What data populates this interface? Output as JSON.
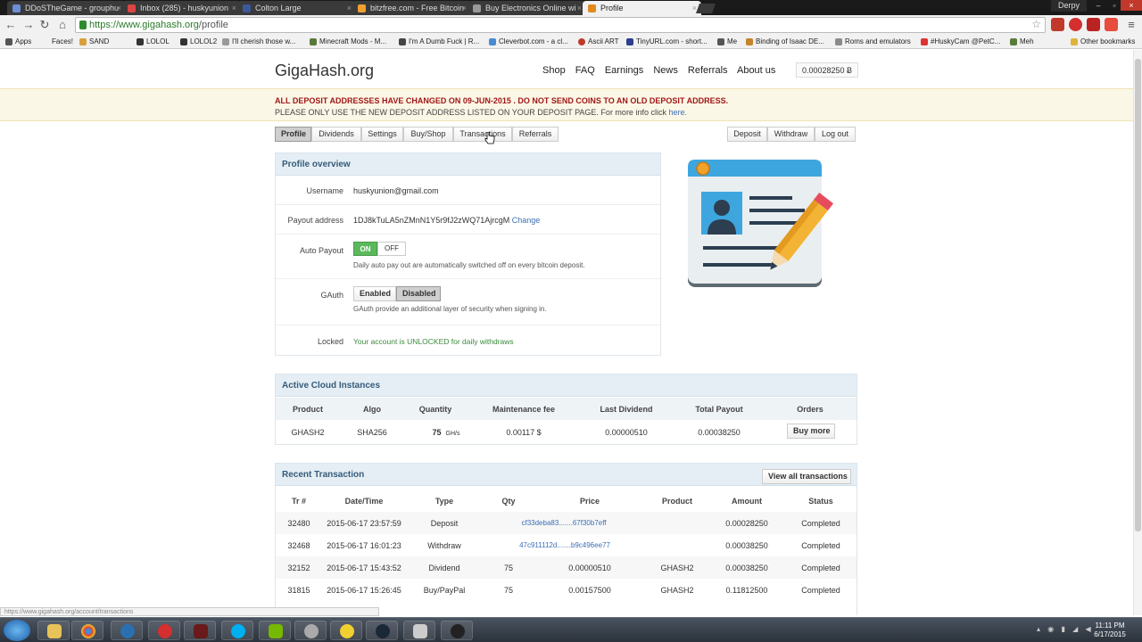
{
  "browser": {
    "tabs": [
      {
        "title": "DDoSTheGame - grouphu",
        "active": false
      },
      {
        "title": "Inbox (285) - huskyunion",
        "active": false
      },
      {
        "title": "Colton Large",
        "active": false
      },
      {
        "title": "bitzfree.com - Free Bitcoin",
        "active": false
      },
      {
        "title": "Buy Electronics Online wi",
        "active": false
      },
      {
        "title": "Profile",
        "active": true
      }
    ],
    "user": "Derpy",
    "url_host": "https://www.gigahash.org",
    "url_path": "/profile",
    "bookmarks": [
      "Apps",
      "Faces!",
      "SAND",
      "LOLOL",
      "LOLOL2",
      "I'll cherish those w...",
      "Minecraft Mods - M...",
      "I'm A Dumb Fuck | R...",
      "Cleverbot.com - a cl...",
      "Ascii ART",
      "TinyURL.com - short...",
      "Me",
      "Binding of Isaac DE...",
      "Roms and emulators",
      "#HuskyCam @PetC...",
      "Meh",
      "Other bookmarks"
    ],
    "status_url": "https://www.gigahash.org/account/transactions"
  },
  "site": {
    "logo": "GigaHash.org",
    "nav": [
      "Shop",
      "FAQ",
      "Earnings",
      "News",
      "Referrals",
      "About us"
    ],
    "balance": "0.00028250 Ƀ",
    "notice_line1": "ALL DEPOSIT ADDRESSES HAVE CHANGED ON 09-JUN-2015 . DO NOT SEND COINS TO AN OLD DEPOSIT ADDRESS.",
    "notice_line2": "PLEASE ONLY USE THE NEW DEPOSIT ADDRESS LISTED ON YOUR DEPOSIT PAGE. For more info click ",
    "notice_link": "here."
  },
  "subnav": {
    "left": [
      "Profile",
      "Dividends",
      "Settings",
      "Buy/Shop",
      "Transactions",
      "Referrals"
    ],
    "right": [
      "Deposit",
      "Withdraw",
      "Log out"
    ],
    "active": "Profile"
  },
  "profile": {
    "title": "Profile overview",
    "username_label": "Username",
    "username": "huskyunion@gmail.com",
    "payout_label": "Payout address",
    "payout_address": "1DJ8kTuLA5nZMnN1Y5r9fJ2zWQ71AjrcgM",
    "payout_change": "Change",
    "autopayout_label": "Auto Payout",
    "toggle_on": "ON",
    "toggle_off": "OFF",
    "autopayout_hint": "Daily auto pay out are automatically switched off on every bitcoin deposit.",
    "gauth_label": "GAuth",
    "gauth_enabled": "Enabled",
    "gauth_disabled": "Disabled",
    "gauth_hint": "GAuth provide an additional layer of security when signing in.",
    "locked_label": "Locked",
    "locked_value": "Your account is UNLOCKED for daily withdraws"
  },
  "instances": {
    "title": "Active Cloud Instances",
    "headers": [
      "Product",
      "Algo",
      "Quantity",
      "Maintenance fee",
      "Last Dividend",
      "Total Payout",
      "Orders"
    ],
    "row": {
      "product": "GHASH2",
      "algo": "SHA256",
      "quantity": "75",
      "unit": "GH/s",
      "fee": "0.00117 $",
      "last_dividend": "0.00000510",
      "total_payout": "0.00038250",
      "action": "Buy more"
    }
  },
  "transactions": {
    "title": "Recent Transaction",
    "view_all": "View all transactions",
    "headers": [
      "Tr #",
      "Date/Time",
      "Type",
      "Qty",
      "Price",
      "Product",
      "Amount",
      "Status"
    ],
    "rows": [
      [
        "32480",
        "2015-06-17 23:57:59",
        "Deposit",
        "",
        "cf33deba83.......67f30b7eff",
        "",
        "0.00028250",
        "Completed"
      ],
      [
        "32468",
        "2015-06-17 16:01:23",
        "Withdraw",
        "",
        "47c911112d.......b9c496ee77",
        "",
        "0.00038250",
        "Completed"
      ],
      [
        "32152",
        "2015-06-17 15:43:52",
        "Dividend",
        "75",
        "0.00000510",
        "GHASH2",
        "0.00038250",
        "Completed"
      ],
      [
        "31815",
        "2015-06-17 15:26:45",
        "Buy/PayPal",
        "75",
        "0.00157500",
        "GHASH2",
        "0.11812500",
        "Completed"
      ]
    ]
  },
  "taskbar": {
    "time": "11:11 PM",
    "date": "6/17/2015"
  }
}
